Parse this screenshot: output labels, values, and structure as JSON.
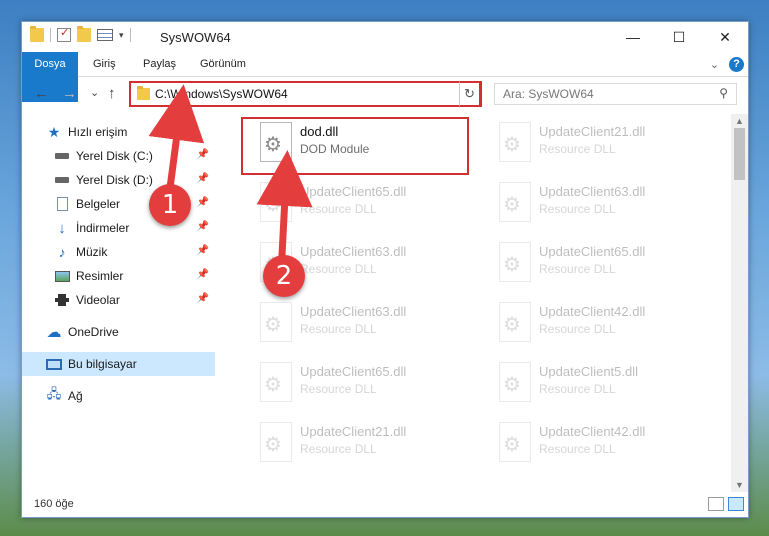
{
  "window": {
    "title": "SysWOW64"
  },
  "window_buttons": {
    "minimize": "—",
    "maximize": "☐",
    "close": "✕"
  },
  "ribbon": {
    "tabs": [
      "Dosya",
      "Giriş",
      "Paylaş",
      "Görünüm"
    ]
  },
  "nav": {
    "back": "←",
    "forward": "→",
    "recent": "⌄",
    "up": "↑"
  },
  "address": {
    "path": "C:\\Windows\\SysWOW64"
  },
  "search": {
    "placeholder": "Ara: SysWOW64"
  },
  "sidebar": {
    "items": [
      {
        "label": "Hızlı erişim",
        "icon": "star-icon"
      },
      {
        "label": "Yerel Disk (C:)",
        "icon": "disk-icon",
        "pinned": true
      },
      {
        "label": "Yerel Disk (D:)",
        "icon": "disk-icon",
        "pinned": true
      },
      {
        "label": "Belgeler",
        "icon": "document-icon",
        "pinned": true
      },
      {
        "label": "İndirmeler",
        "icon": "download-icon",
        "pinned": true
      },
      {
        "label": "Müzik",
        "icon": "music-icon",
        "pinned": true
      },
      {
        "label": "Resimler",
        "icon": "pictures-icon",
        "pinned": true
      },
      {
        "label": "Videolar",
        "icon": "video-icon",
        "pinned": true
      },
      {
        "label": "OneDrive",
        "icon": "cloud-icon"
      },
      {
        "label": "Bu bilgisayar",
        "icon": "computer-icon",
        "selected": true
      },
      {
        "label": "Ağ",
        "icon": "network-icon"
      }
    ]
  },
  "files": [
    {
      "name": "dod.dll",
      "type": "DOD Module"
    },
    {
      "name": "UpdateClient21.dll",
      "type": "Resource DLL"
    },
    {
      "name": "UpdateClient65.dll",
      "type": "Resource DLL"
    },
    {
      "name": "UpdateClient63.dll",
      "type": "Resource DLL"
    },
    {
      "name": "UpdateClient63.dll",
      "type": "Resource DLL"
    },
    {
      "name": "UpdateClient65.dll",
      "type": "Resource DLL"
    },
    {
      "name": "UpdateClient63.dll",
      "type": "Resource DLL"
    },
    {
      "name": "UpdateClient42.dll",
      "type": "Resource DLL"
    },
    {
      "name": "UpdateClient65.dll",
      "type": "Resource DLL"
    },
    {
      "name": "UpdateClient5.dll",
      "type": "Resource DLL"
    },
    {
      "name": "UpdateClient21.dll",
      "type": "Resource DLL"
    },
    {
      "name": "UpdateClient42.dll",
      "type": "Resource DLL"
    }
  ],
  "status": {
    "item_count": "160 öğe"
  },
  "callouts": {
    "step1": "1",
    "step2": "2"
  },
  "colors": {
    "accent": "#1979ca",
    "callout_red": "#e43d3d",
    "highlight_red": "#d32f2f",
    "selection": "#cce8ff"
  }
}
